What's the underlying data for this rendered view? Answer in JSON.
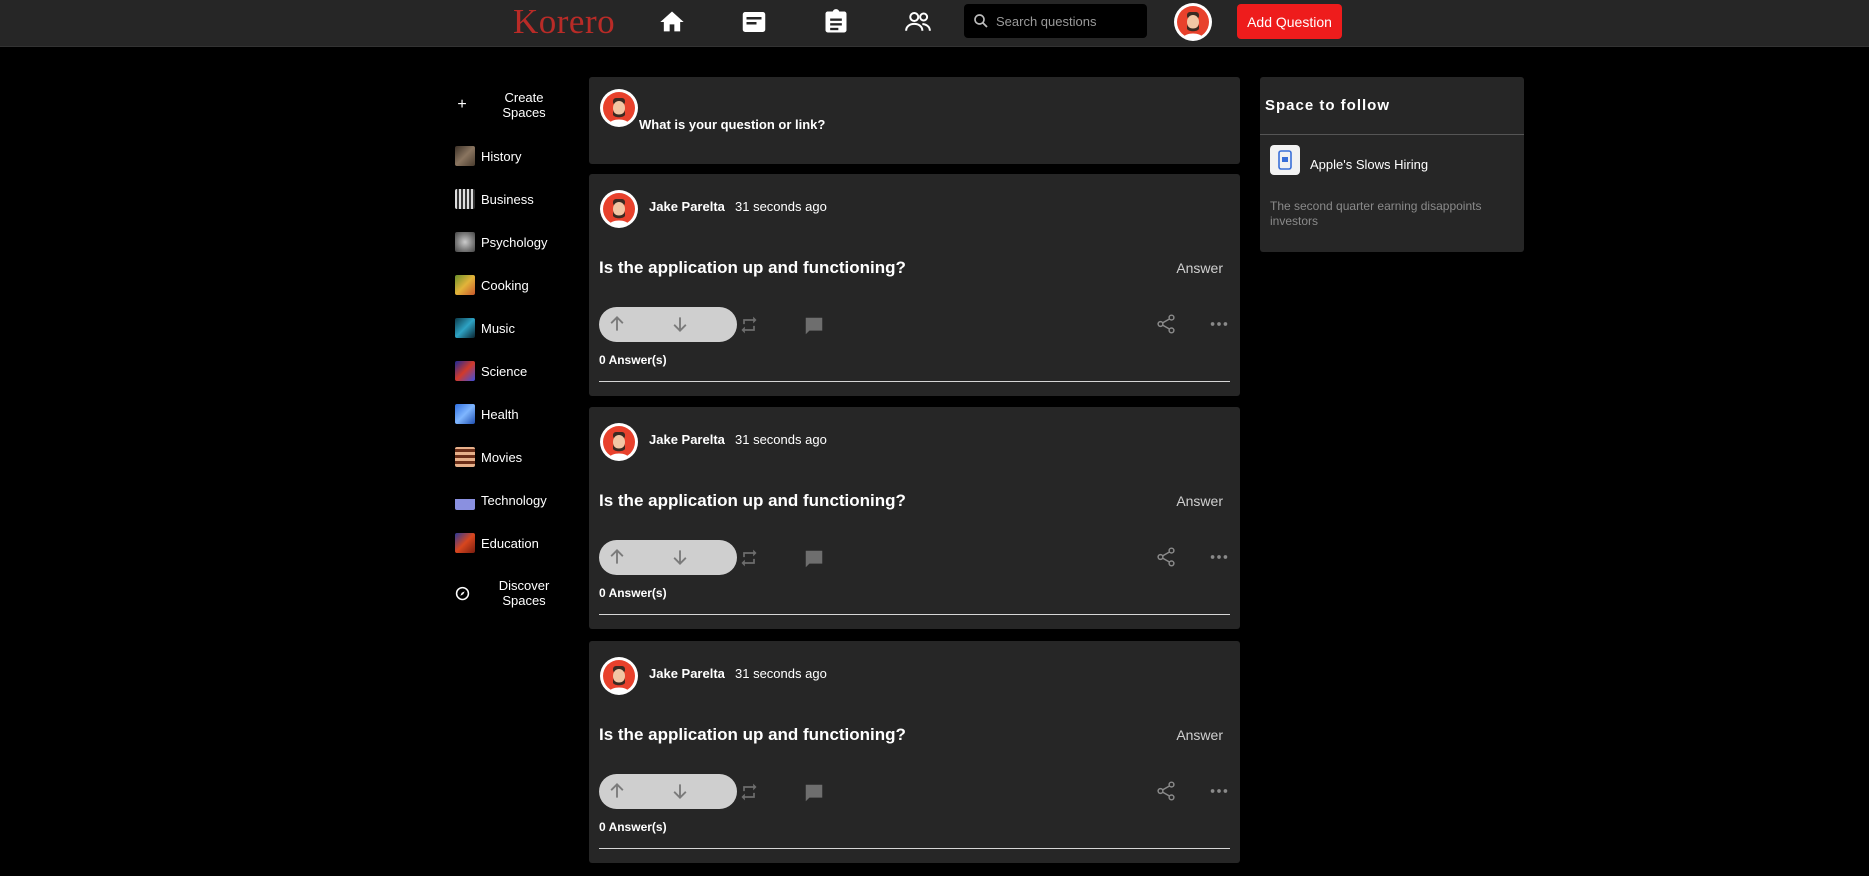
{
  "app": {
    "logo": "Korero"
  },
  "header": {
    "nav_icons": [
      "home-icon",
      "news-icon",
      "clipboard-icon",
      "people-icon"
    ],
    "search_placeholder": "Search questions",
    "add_question_label": "Add Question"
  },
  "sidebar": {
    "create_label": "Create Spaces",
    "discover_label": "Discover Spaces",
    "items": [
      {
        "label": "History",
        "color": "#6b5a48"
      },
      {
        "label": "Business",
        "color": "#8a8a8a"
      },
      {
        "label": "Psychology",
        "color": "#9a9a9a"
      },
      {
        "label": "Cooking",
        "color": "#b8901e"
      },
      {
        "label": "Music",
        "color": "#1d6f87"
      },
      {
        "label": "Science",
        "color": "#3645c8"
      },
      {
        "label": "Health",
        "color": "#3a7bd5"
      },
      {
        "label": "Movies",
        "color": "#a0542e"
      },
      {
        "label": "Technology",
        "color": "#7f86d6"
      },
      {
        "label": "Education",
        "color": "#c0431e"
      }
    ]
  },
  "ask_box": {
    "prompt": "What is your question or link?"
  },
  "posts": [
    {
      "author": "Jake Parelta",
      "time": "31 seconds ago",
      "question": "Is the application up and functioning?",
      "answer_label": "Answer",
      "answers_count": "0 Answer(s)"
    },
    {
      "author": "Jake Parelta",
      "time": "31 seconds ago",
      "question": "Is the application up and functioning?",
      "answer_label": "Answer",
      "answers_count": "0 Answer(s)"
    },
    {
      "author": "Jake Parelta",
      "time": "31 seconds ago",
      "question": "Is the application up and functioning?",
      "answer_label": "Answer",
      "answers_count": "0 Answer(s)"
    }
  ],
  "right_panel": {
    "title": "Space to follow",
    "space_name": "Apple's Slows Hiring",
    "space_description": "The second quarter earning disappoints investors"
  },
  "colors": {
    "accent": "#ee1c1c",
    "logo": "#b92b27",
    "card": "#262626"
  }
}
